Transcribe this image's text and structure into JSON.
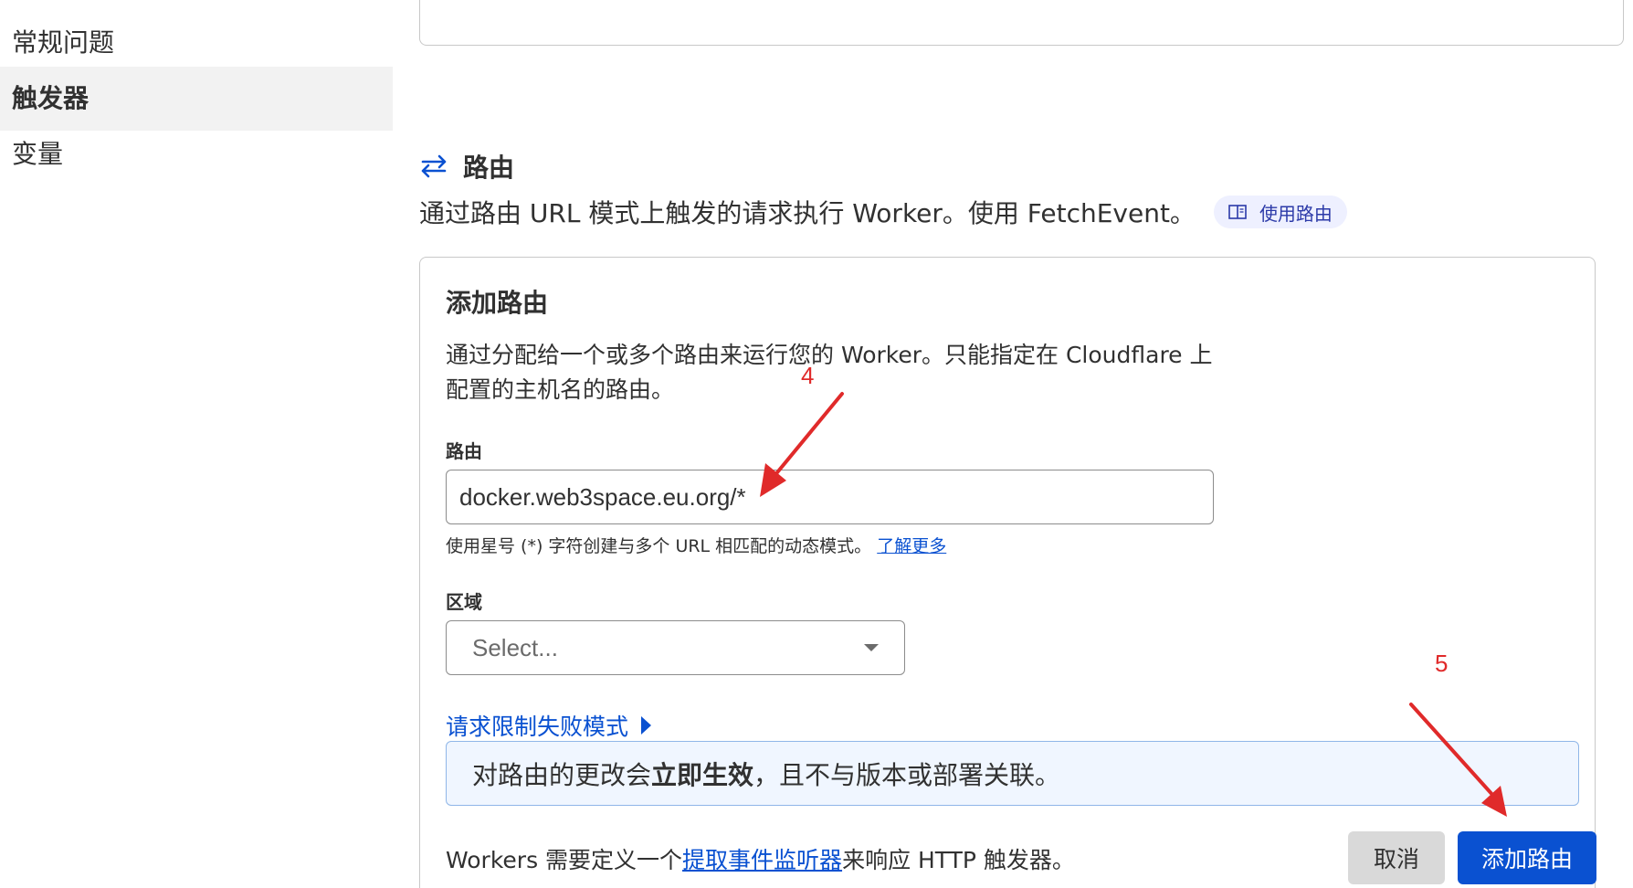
{
  "sidebar": {
    "items": [
      {
        "label": "常规问题"
      },
      {
        "label": "触发器",
        "active": true
      },
      {
        "label": "变量"
      }
    ]
  },
  "routes_section": {
    "icon": "arrows-swap-icon",
    "title": "路由",
    "description": "通过路由 URL 模式上触发的请求执行 Worker。使用 FetchEvent。",
    "doc_link_icon": "book-icon",
    "doc_link_label": "使用路由"
  },
  "add_route": {
    "title": "添加路由",
    "description": "通过分配给一个或多个路由来运行您的 Worker。只能指定在 Cloudflare 上配置的主机名的路由。",
    "route_label": "路由",
    "route_value": "docker.web3space.eu.org/*",
    "route_helper": "使用星号 (*) 字符创建与多个 URL 相匹配的动态模式。",
    "route_helper_link": "了解更多",
    "zone_label": "区域",
    "zone_placeholder": "Select...",
    "failure_mode_label": "请求限制失败模式",
    "notice_prefix": "对路由的更改会",
    "notice_bold": "立即生效",
    "notice_suffix": "，且不与版本或部署关联。",
    "footer_prefix": "Workers 需要定义一个",
    "footer_link": "提取事件监听器",
    "footer_suffix": "来响应 HTTP 触发器。",
    "cancel_label": "取消",
    "submit_label": "添加路由"
  },
  "annotations": {
    "step_4": "4",
    "step_5": "5",
    "arrow_color": "#e02a2a"
  },
  "colors": {
    "accent": "#0a51d1",
    "active_sidebar_bg": "#f2f2f2",
    "notice_bg": "#f0f6ff"
  }
}
